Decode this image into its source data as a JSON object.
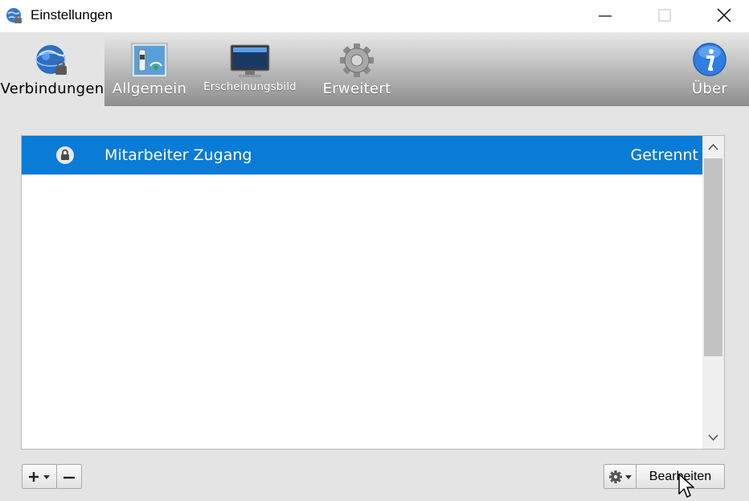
{
  "window": {
    "title": "Einstellungen"
  },
  "toolbar": {
    "items": [
      {
        "id": "verbindungen",
        "label": "Verbindungen",
        "active": true
      },
      {
        "id": "allgemein",
        "label": "Allgemein",
        "active": false
      },
      {
        "id": "erscheinungsbild",
        "label": "Erscheinungsbild",
        "active": false
      },
      {
        "id": "erweitert",
        "label": "Erweitert",
        "active": false
      },
      {
        "id": "ueber",
        "label": "Über",
        "active": false
      }
    ]
  },
  "connections": [
    {
      "name": "Mitarbeiter Zugang",
      "status": "Getrennt",
      "selected": true,
      "icon": "lock-icon"
    }
  ],
  "footer": {
    "add_icon": "plus-icon",
    "remove_icon": "minus-icon",
    "gear_icon": "gear-icon",
    "edit_label": "Bearbeiten"
  },
  "colors": {
    "selection": "#0a7bd6",
    "window_bg": "#e4e4e4"
  }
}
